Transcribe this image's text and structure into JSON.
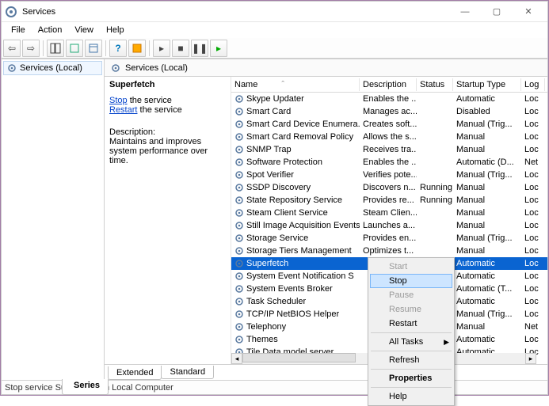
{
  "window": {
    "title": "Services",
    "min_icon": "—",
    "max_icon": "▢",
    "close_icon": "✕"
  },
  "menu": {
    "file": "File",
    "action": "Action",
    "view": "View",
    "help": "Help"
  },
  "leftpane": {
    "root": "Services (Local)"
  },
  "rhead": {
    "title": "Services (Local)"
  },
  "desc": {
    "svcname": "Superfetch",
    "stop_link": "Stop",
    "stop_rest": " the service",
    "restart_link": "Restart",
    "restart_rest": " the service",
    "desc_label": "Description:",
    "desc_text": "Maintains and improves system performance over time."
  },
  "cols": {
    "name": "Name",
    "desc": "Description",
    "status": "Status",
    "startup": "Startup Type",
    "log": "Log"
  },
  "rows": [
    {
      "name": "Skype Updater",
      "desc": "Enables the ...",
      "status": "",
      "startup": "Automatic",
      "log": "Loc"
    },
    {
      "name": "Smart Card",
      "desc": "Manages ac...",
      "status": "",
      "startup": "Disabled",
      "log": "Loc"
    },
    {
      "name": "Smart Card Device Enumera...",
      "desc": "Creates soft...",
      "status": "",
      "startup": "Manual (Trig...",
      "log": "Loc"
    },
    {
      "name": "Smart Card Removal Policy",
      "desc": "Allows the s...",
      "status": "",
      "startup": "Manual",
      "log": "Loc"
    },
    {
      "name": "SNMP Trap",
      "desc": "Receives tra...",
      "status": "",
      "startup": "Manual",
      "log": "Loc"
    },
    {
      "name": "Software Protection",
      "desc": "Enables the ...",
      "status": "",
      "startup": "Automatic (D...",
      "log": "Net"
    },
    {
      "name": "Spot Verifier",
      "desc": "Verifies pote...",
      "status": "",
      "startup": "Manual (Trig...",
      "log": "Loc"
    },
    {
      "name": "SSDP Discovery",
      "desc": "Discovers n...",
      "status": "Running",
      "startup": "Manual",
      "log": "Loc"
    },
    {
      "name": "State Repository Service",
      "desc": "Provides re...",
      "status": "Running",
      "startup": "Manual",
      "log": "Loc"
    },
    {
      "name": "Steam Client Service",
      "desc": "Steam Clien...",
      "status": "",
      "startup": "Manual",
      "log": "Loc"
    },
    {
      "name": "Still Image Acquisition Events",
      "desc": "Launches a...",
      "status": "",
      "startup": "Manual",
      "log": "Loc"
    },
    {
      "name": "Storage Service",
      "desc": "Provides en...",
      "status": "",
      "startup": "Manual (Trig...",
      "log": "Loc"
    },
    {
      "name": "Storage Tiers Management",
      "desc": "Optimizes t...",
      "status": "",
      "startup": "Manual",
      "log": "Loc"
    },
    {
      "name": "Superfetch",
      "desc": "",
      "status": "",
      "startup": "Automatic",
      "log": "Loc",
      "selected": true
    },
    {
      "name": "System Event Notification S",
      "desc": "",
      "status": "",
      "startup": "Automatic",
      "log": "Loc"
    },
    {
      "name": "System Events Broker",
      "desc": "",
      "status": "",
      "startup": "Automatic (T...",
      "log": "Loc"
    },
    {
      "name": "Task Scheduler",
      "desc": "",
      "status": "",
      "startup": "Automatic",
      "log": "Loc"
    },
    {
      "name": "TCP/IP NetBIOS Helper",
      "desc": "",
      "status": "",
      "startup": "Manual (Trig...",
      "log": "Loc"
    },
    {
      "name": "Telephony",
      "desc": "",
      "status": "",
      "startup": "Manual",
      "log": "Net"
    },
    {
      "name": "Themes",
      "desc": "",
      "status": "",
      "startup": "Automatic",
      "log": "Loc"
    },
    {
      "name": "Tile Data model server",
      "desc": "",
      "status": "",
      "startup": "Automatic",
      "log": "Loc"
    }
  ],
  "ctx": {
    "start": "Start",
    "stop": "Stop",
    "pause": "Pause",
    "resume": "Resume",
    "restart": "Restart",
    "alltasks": "All Tasks",
    "refresh": "Refresh",
    "properties": "Properties",
    "help": "Help"
  },
  "tabs": {
    "extended": "Extended",
    "standard": "Standard"
  },
  "status": "Stop service Superfetch on Local Computer",
  "bottombar": "Series"
}
